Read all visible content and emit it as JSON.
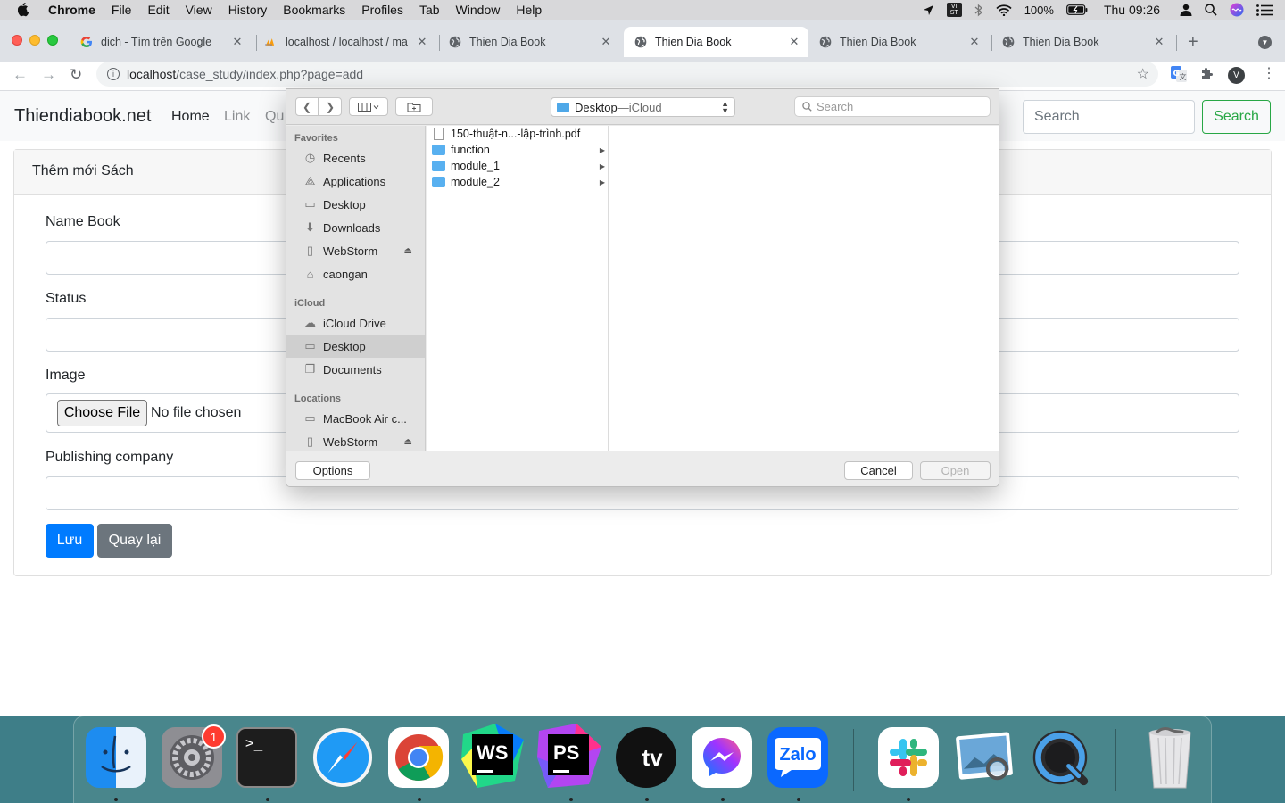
{
  "menubar": {
    "app_name": "Chrome",
    "items": [
      "File",
      "Edit",
      "View",
      "History",
      "Bookmarks",
      "Profiles",
      "Tab",
      "Window",
      "Help"
    ],
    "input_source": "VI ST",
    "battery": "100%",
    "clock": "Thu 09:26"
  },
  "tabs": [
    {
      "title": "dich - Tìm trên Google",
      "icon": "google-icon",
      "active": false
    },
    {
      "title": "localhost / localhost / ma",
      "icon": "phpmyadmin-icon",
      "active": false
    },
    {
      "title": "Thien Dia Book",
      "icon": "globe-icon",
      "active": false
    },
    {
      "title": "Thien Dia Book",
      "icon": "globe-icon",
      "active": true
    },
    {
      "title": "Thien Dia Book",
      "icon": "globe-icon",
      "active": false
    },
    {
      "title": "Thien Dia Book",
      "icon": "globe-icon",
      "active": false
    }
  ],
  "omnibox": {
    "host": "localhost",
    "path": "/case_study/index.php?page=add"
  },
  "profile_initial": "V",
  "site": {
    "brand": "Thiendiabook.net",
    "nav": {
      "home": "Home",
      "link": "Link",
      "more": "Qu"
    },
    "search_placeholder": "Search",
    "search_button": "Search"
  },
  "form": {
    "header": "Thêm mới Sách",
    "name_label": "Name Book",
    "status_label": "Status",
    "image_label": "Image",
    "choose_file": "Choose File",
    "no_file": "No file chosen",
    "publisher_label": "Publishing company",
    "save": "Lưu",
    "back": "Quay lại"
  },
  "dialog": {
    "location_name": "Desktop",
    "location_sep": " — ",
    "location_source": "iCloud",
    "search_placeholder": "Search",
    "favorites_title": "Favorites",
    "favorites": [
      {
        "label": "Recents",
        "icon": "clock-icon"
      },
      {
        "label": "Applications",
        "icon": "applications-icon"
      },
      {
        "label": "Desktop",
        "icon": "desktop-icon"
      },
      {
        "label": "Downloads",
        "icon": "download-icon"
      },
      {
        "label": "WebStorm",
        "icon": "disk-icon",
        "eject": true
      },
      {
        "label": "caongan",
        "icon": "home-icon"
      }
    ],
    "icloud_title": "iCloud",
    "icloud": [
      {
        "label": "iCloud Drive",
        "icon": "cloud-icon"
      },
      {
        "label": "Desktop",
        "icon": "desktop-icon",
        "selected": true
      },
      {
        "label": "Documents",
        "icon": "documents-icon"
      }
    ],
    "locations_title": "Locations",
    "locations": [
      {
        "label": "MacBook Air c...",
        "icon": "laptop-icon"
      },
      {
        "label": "WebStorm",
        "icon": "disk-icon",
        "eject": true
      }
    ],
    "files": [
      {
        "name": "150-thuật-n...-lập-trình.pdf",
        "kind": "pdf"
      },
      {
        "name": "function",
        "kind": "folder"
      },
      {
        "name": "module_1",
        "kind": "folder"
      },
      {
        "name": "module_2",
        "kind": "folder"
      }
    ],
    "options": "Options",
    "cancel": "Cancel",
    "open": "Open"
  },
  "dock": {
    "badge": "1",
    "apps": [
      "Finder",
      "System Preferences",
      "Terminal",
      "Safari",
      "Google Chrome",
      "WebStorm",
      "PhpStorm",
      "Apple TV",
      "Messenger",
      "Zalo",
      "Slack",
      "Preview",
      "QuickTime Player",
      "Trash"
    ],
    "ws_label": "WS",
    "ps_label": "PS",
    "tv_label": "tv",
    "zalo_label": "Zalo",
    "terminal_label": ">_"
  }
}
